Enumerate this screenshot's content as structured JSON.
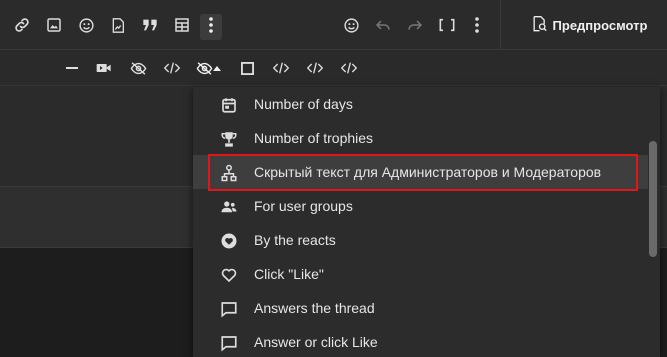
{
  "toolbar": {
    "preview_label": "Предпросмотр"
  },
  "dropdown": {
    "items": [
      {
        "label": "Number of days",
        "icon": "calendar-icon"
      },
      {
        "label": "Number of trophies",
        "icon": "trophy-icon"
      },
      {
        "label": "Скрытый текст для Администраторов и Модераторов",
        "icon": "sitemap-icon"
      },
      {
        "label": "For user groups",
        "icon": "user-group-icon"
      },
      {
        "label": "By the reacts",
        "icon": "heart-circle-icon"
      },
      {
        "label": "Click \"Like\"",
        "icon": "heart-icon"
      },
      {
        "label": "Answers the thread",
        "icon": "comment-icon"
      },
      {
        "label": "Answer or click Like",
        "icon": "comment-icon"
      }
    ]
  },
  "colors": {
    "highlight": "#e0161a",
    "background": "#242424",
    "dropdown_bg": "#2c2c2c"
  }
}
